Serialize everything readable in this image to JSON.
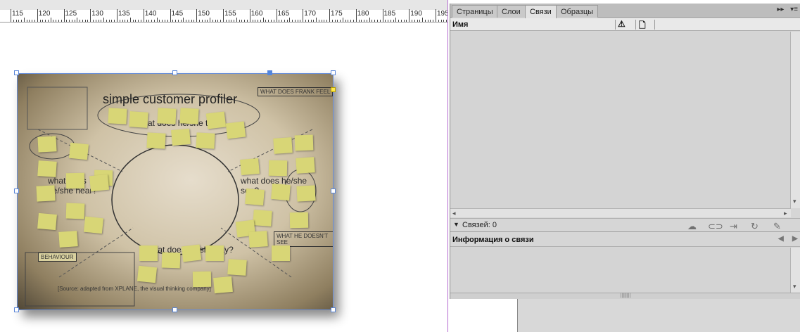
{
  "ruler": {
    "labels": [
      "115",
      "120",
      "125",
      "130",
      "135",
      "140",
      "145",
      "150",
      "155",
      "160",
      "165",
      "170",
      "175",
      "180",
      "185",
      "190",
      "195"
    ]
  },
  "image": {
    "title": "simple customer profiler",
    "texts": {
      "think": "What does he/she think",
      "hear": "what does he/she hear?",
      "see": "what does he/she see?",
      "say": "what does he/she say?",
      "feel": "WHAT DOES FRANK FEEL",
      "doesnt_see": "WHAT HE DOESN'T SEE",
      "behaviour": "BEHAVIOUR",
      "source": "[Source: adapted from XPLANE, the visual thinking company]"
    }
  },
  "panel": {
    "tabs": [
      "Страницы",
      "Слои",
      "Связи",
      "Образцы"
    ],
    "active_tab": "Связи",
    "tabs_collapse_icon": "double-chevron-right-icon",
    "tabs_menu_icon": "panel-menu-icon",
    "column_name": "Имя",
    "status_label": "Связей: 0",
    "status_icons": [
      "cloud-icon",
      "relink-icon",
      "goto-link-icon",
      "update-link-icon",
      "edit-original-icon"
    ],
    "info_title": "Информация о связи"
  }
}
